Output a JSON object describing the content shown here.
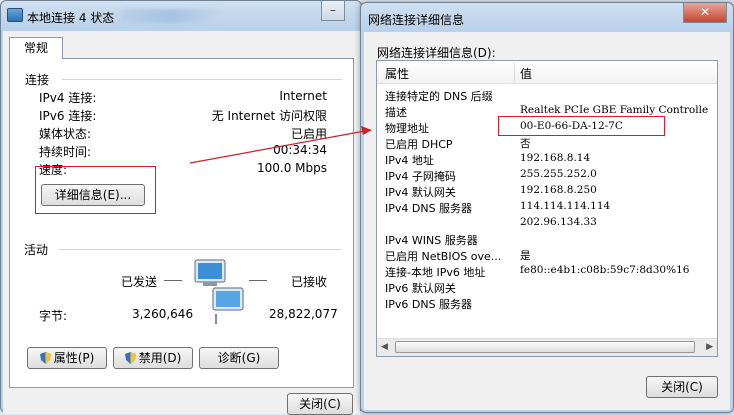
{
  "status_window": {
    "title": "本地连接 4 状态",
    "tab": "常规",
    "connection_header": "连接",
    "rows": [
      {
        "label": "IPv4 连接:",
        "value": "Internet"
      },
      {
        "label": "IPv6 连接:",
        "value": "无 Internet 访问权限"
      },
      {
        "label": "媒体状态:",
        "value": "已启用"
      },
      {
        "label": "持续时间:",
        "value": "00:34:34"
      },
      {
        "label": "速度:",
        "value": "100.0 Mbps"
      }
    ],
    "details_button": "详细信息(E)...",
    "activity_header": "活动",
    "sent_label": "已发送",
    "received_label": "已接收",
    "bytes_label": "字节:",
    "bytes_sent": "3,260,646",
    "bytes_received": "28,822,077",
    "buttons": {
      "properties": "属性(P)",
      "disable": "禁用(D)",
      "diagnose": "诊断(G)"
    },
    "close_button": "关闭(C)"
  },
  "detail_window": {
    "title": "网络连接详细信息",
    "list_label": "网络连接详细信息(D):",
    "columns": {
      "property": "属性",
      "value": "值"
    },
    "rows": [
      {
        "property": "连接特定的 DNS 后缀",
        "value": ""
      },
      {
        "property": "描述",
        "value": "Realtek PCIe GBE Family Controlle"
      },
      {
        "property": "物理地址",
        "value": "00-E0-66-DA-12-7C"
      },
      {
        "property": "已启用 DHCP",
        "value": "否"
      },
      {
        "property": "IPv4 地址",
        "value": "192.168.8.14"
      },
      {
        "property": "IPv4 子网掩码",
        "value": "255.255.252.0"
      },
      {
        "property": "IPv4 默认网关",
        "value": "192.168.8.250"
      },
      {
        "property": "IPv4 DNS 服务器",
        "value": "114.114.114.114"
      },
      {
        "property": "",
        "value": "202.96.134.33"
      },
      {
        "property": "IPv4 WINS 服务器",
        "value": ""
      },
      {
        "property": "已启用 NetBIOS ove...",
        "value": "是"
      },
      {
        "property": "连接-本地 IPv6 地址",
        "value": "fe80::e4b1:c08b:59c7:8d30%16"
      },
      {
        "property": "IPv6 默认网关",
        "value": ""
      },
      {
        "property": "IPv6 DNS 服务器",
        "value": ""
      }
    ],
    "close_button": "关闭(C)"
  },
  "colors": {
    "highlight": "#d0202a",
    "window_frame": "#b9d1ea"
  },
  "icons": [
    "network-computer-icon",
    "shield-icon"
  ]
}
